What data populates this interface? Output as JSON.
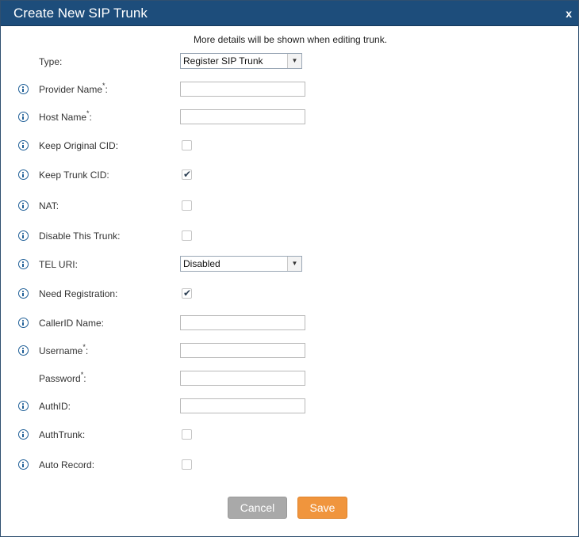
{
  "dialog": {
    "title": "Create New SIP Trunk",
    "close_label": "x",
    "note": "More details will be shown when editing trunk."
  },
  "fields": {
    "type": {
      "label": "Type:",
      "value": "Register SIP Trunk"
    },
    "provider_name": {
      "label": "Provider Name",
      "required": "*",
      "colon": ":",
      "value": ""
    },
    "host_name": {
      "label": "Host Name",
      "required": "*",
      "colon": ":",
      "value": ""
    },
    "keep_original_cid": {
      "label": "Keep Original CID:",
      "checked": false
    },
    "keep_trunk_cid": {
      "label": "Keep Trunk CID:",
      "checked": true
    },
    "nat": {
      "label": "NAT:",
      "checked": false
    },
    "disable_this_trunk": {
      "label": "Disable This Trunk:",
      "checked": false
    },
    "tel_uri": {
      "label": "TEL URI:",
      "value": "Disabled"
    },
    "need_registration": {
      "label": "Need Registration:",
      "checked": true
    },
    "callerid_name": {
      "label": "CallerID Name:",
      "value": ""
    },
    "username": {
      "label": "Username",
      "required": "*",
      "colon": ":",
      "value": ""
    },
    "password": {
      "label": "Password",
      "required": "*",
      "colon": ":",
      "value": ""
    },
    "authid": {
      "label": "AuthID:",
      "value": ""
    },
    "authtrunk": {
      "label": "AuthTrunk:",
      "checked": false
    },
    "auto_record": {
      "label": "Auto Record:",
      "checked": false
    }
  },
  "icons": {
    "info": "info-icon",
    "dropdown": "chevron-down-icon",
    "check": "checkmark-icon"
  },
  "buttons": {
    "cancel": "Cancel",
    "save": "Save"
  },
  "colors": {
    "titlebar": "#1d4d7b",
    "info_icon": "#1f5f97",
    "cancel_button": "#a9a9a9",
    "save_button": "#f0953d"
  }
}
